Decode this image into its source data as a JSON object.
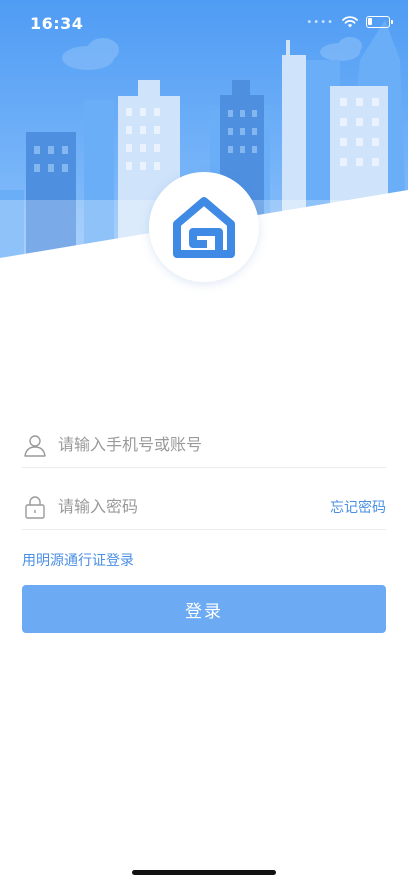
{
  "status_bar": {
    "time": "16:34",
    "battery_level": 0.2
  },
  "icons": {
    "logo": "house-logo-icon",
    "user": "user-icon",
    "lock": "lock-icon",
    "wifi": "wifi-icon",
    "battery": "battery-icon"
  },
  "colors": {
    "accent": "#4a8fe6",
    "button": "#6cabf4",
    "hero_sky": "#5aa3f5"
  },
  "login_form": {
    "account_placeholder": "请输入手机号或账号",
    "account_value": "",
    "password_placeholder": "请输入密码",
    "password_value": "",
    "forgot_password": "忘记密码",
    "passport_login": "用明源通行证登录",
    "login_button": "登录"
  }
}
